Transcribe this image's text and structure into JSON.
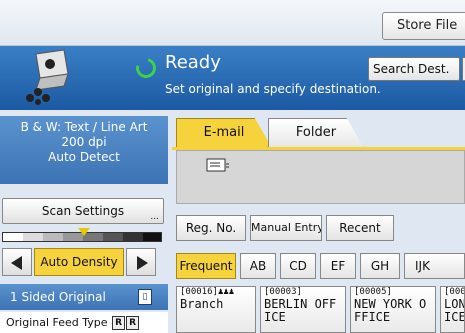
{
  "header": {
    "store_file_label": "Store File"
  },
  "status": {
    "ready": "Ready",
    "instruction": "Set original and specify destination.",
    "search_dest_label": "Search Dest."
  },
  "scan": {
    "mode": "B & W: Text / Line Art",
    "resolution": "200 dpi",
    "size": "Auto Detect",
    "settings_label": "Scan Settings",
    "settings_more": "...",
    "density_label": "Auto Density",
    "sided_label": "1 Sided Original",
    "feed_label": "Original Feed Type",
    "feed_icons": [
      "R",
      "R"
    ]
  },
  "tabs": {
    "email": "E-mail",
    "folder": "Folder"
  },
  "buttons": {
    "reg_no": "Reg. No.",
    "manual_entry": "Manual Entry",
    "recent": "Recent"
  },
  "index_tabs": [
    "Frequent",
    "AB",
    "CD",
    "EF",
    "GH",
    "IJK"
  ],
  "destinations": [
    {
      "number": "[00016]",
      "name": "Branch",
      "group": true
    },
    {
      "number": "[00003]",
      "name": "BERLIN OFF\nICE"
    },
    {
      "number": "[00005]",
      "name": "NEW YORK O\nFFICE"
    },
    {
      "number": "[000",
      "name": "LON\nICE"
    }
  ],
  "colors": {
    "accent_yellow": "#f6d23c",
    "status_blue": "#2a68b2",
    "ready_green": "#3fd14a"
  }
}
